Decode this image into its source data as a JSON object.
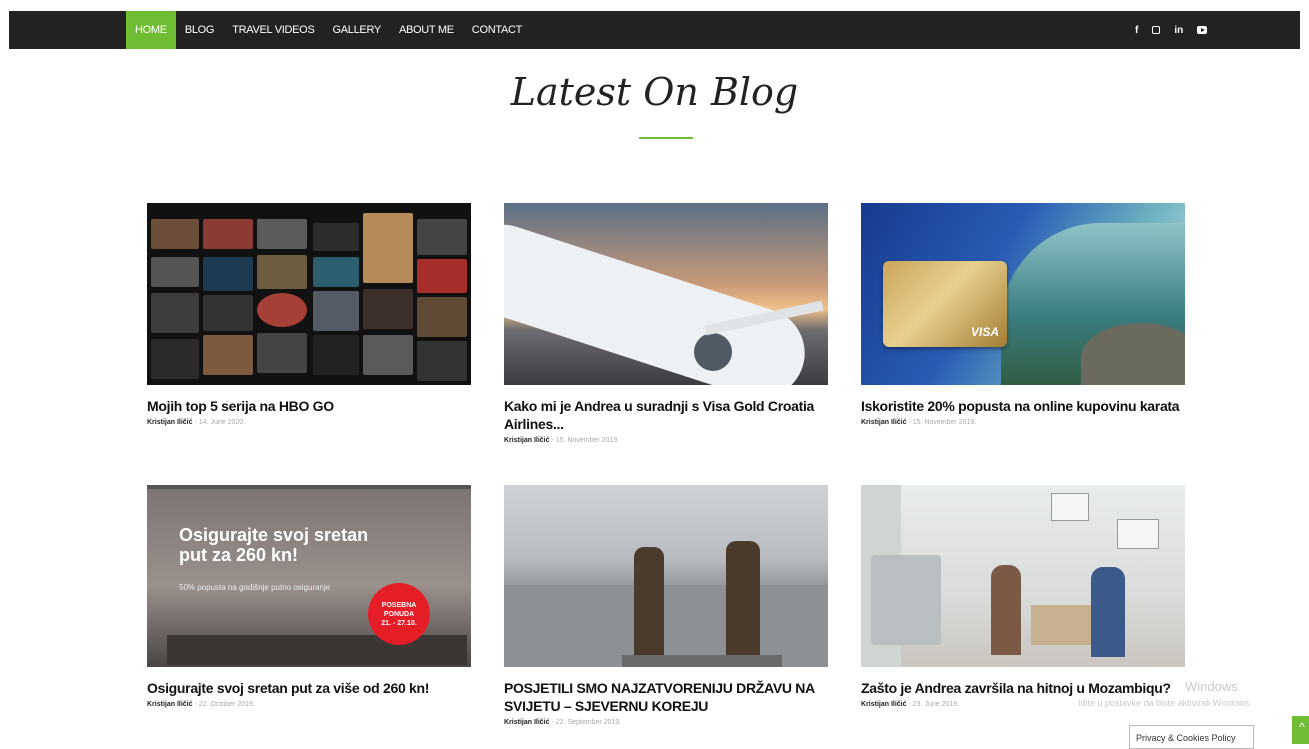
{
  "nav": {
    "items": [
      "HOME",
      "BLOG",
      "TRAVEL VIDEOS",
      "GALLERY",
      "ABOUT ME",
      "CONTACT"
    ],
    "active_index": 0,
    "social": [
      "facebook-icon",
      "instagram-icon",
      "linkedin-icon",
      "youtube-icon"
    ],
    "facebook_glyph": "f",
    "linkedin_glyph": "in"
  },
  "section": {
    "title": "Latest On Blog"
  },
  "colors": {
    "accent": "#6fbd32",
    "navbar": "#222222"
  },
  "posts": [
    {
      "title": "Mojih top 5 serija na HBO GO",
      "author": "Kristijan Iličić",
      "date": "14. June 2020."
    },
    {
      "title": "Kako mi je Andrea u suradnji s Visa Gold Croatia Airlines...",
      "author": "Kristijan Iličić",
      "date": "15. November 2019."
    },
    {
      "title": "Iskoristite 20% popusta na online kupovinu karata",
      "author": "Kristijan Iličić",
      "date": "15. November 2019."
    },
    {
      "title": "Osigurajte svoj sretan put za više od 260 kn!",
      "author": "Kristijan Iličić",
      "date": "22. October 2019."
    },
    {
      "title": "POSJETILI SMO NAJZATVORENIJU DRŽAVU NA SVIJETU – SJEVERNU KOREJU",
      "author": "Kristijan Iličić",
      "date": "22. September 2019."
    },
    {
      "title": "Zašto je Andrea završila na hitnoj u Mozambiqu?",
      "author": "Kristijan Iličić",
      "date": "23. June 2019."
    }
  ],
  "promo_image": {
    "headline": "Osigurajte svoj sretan put za 260 kn!",
    "subline": "50% popusta na godišnje putno osiguranje",
    "badge_line1": "POSEBNA",
    "badge_line2": "PONUDA",
    "badge_line3": "21. - 27.10."
  },
  "visa_image": {
    "brand": "VISA"
  },
  "overlay": {
    "watermark_title": "Windows",
    "watermark_sub": "Idite u postavke da biste aktivirali Windows.",
    "privacy_button": "Privacy & Cookies Policy",
    "totop_glyph": "^"
  }
}
